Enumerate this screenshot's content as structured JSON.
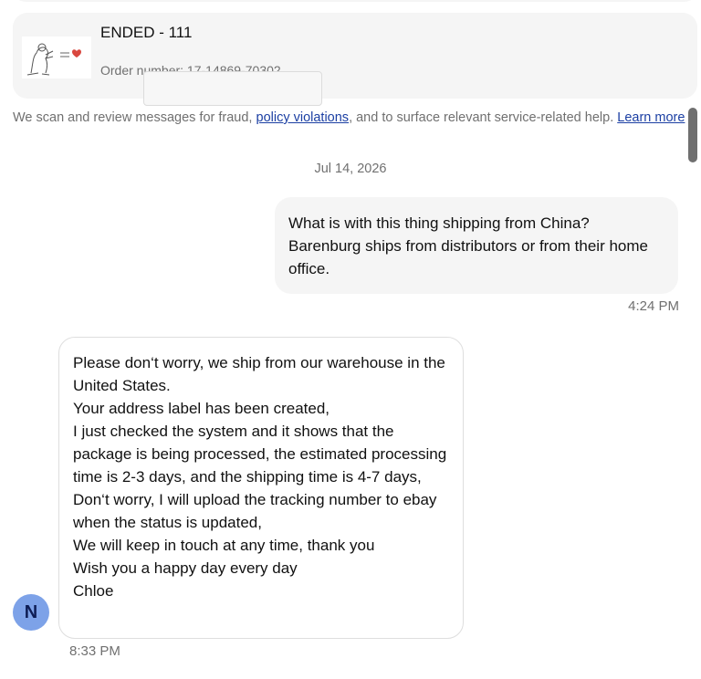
{
  "order_card": {
    "title": "ENDED - 111",
    "order_number": "Order number: 17-14869-70302"
  },
  "notice": {
    "text_before": "We scan and review messages for fraud, ",
    "policy_link": "policy violations",
    "text_middle": ", and to surface relevant service-related help. ",
    "learn_more": "Learn more"
  },
  "conversation": {
    "date_separator": "Jul 14, 2026",
    "outgoing": {
      "lines": [
        "What is with this thing shipping from China?",
        "Barenburg ships from distributors or from their home office."
      ],
      "time": "4:24 PM"
    },
    "incoming": {
      "avatar_letter": "N",
      "lines": [
        "Please don‘t worry, we ship from our warehouse in the United States.",
        "Your address label has been created,",
        "I just checked the system and it shows that the package is being processed, the estimated processing time is 2-3 days, and the shipping time is 4-7 days,",
        "Don‘t worry, I will upload the tracking number to ebay when the status is updated,",
        "We will keep in touch at any time, thank you",
        "Wish you a happy day every day",
        "Chloe"
      ],
      "time": "8:33 PM"
    }
  },
  "colors": {
    "avatar_bg": "#7da2e8",
    "link": "#1b3fa3",
    "bubble_bg": "#f5f5f5"
  }
}
